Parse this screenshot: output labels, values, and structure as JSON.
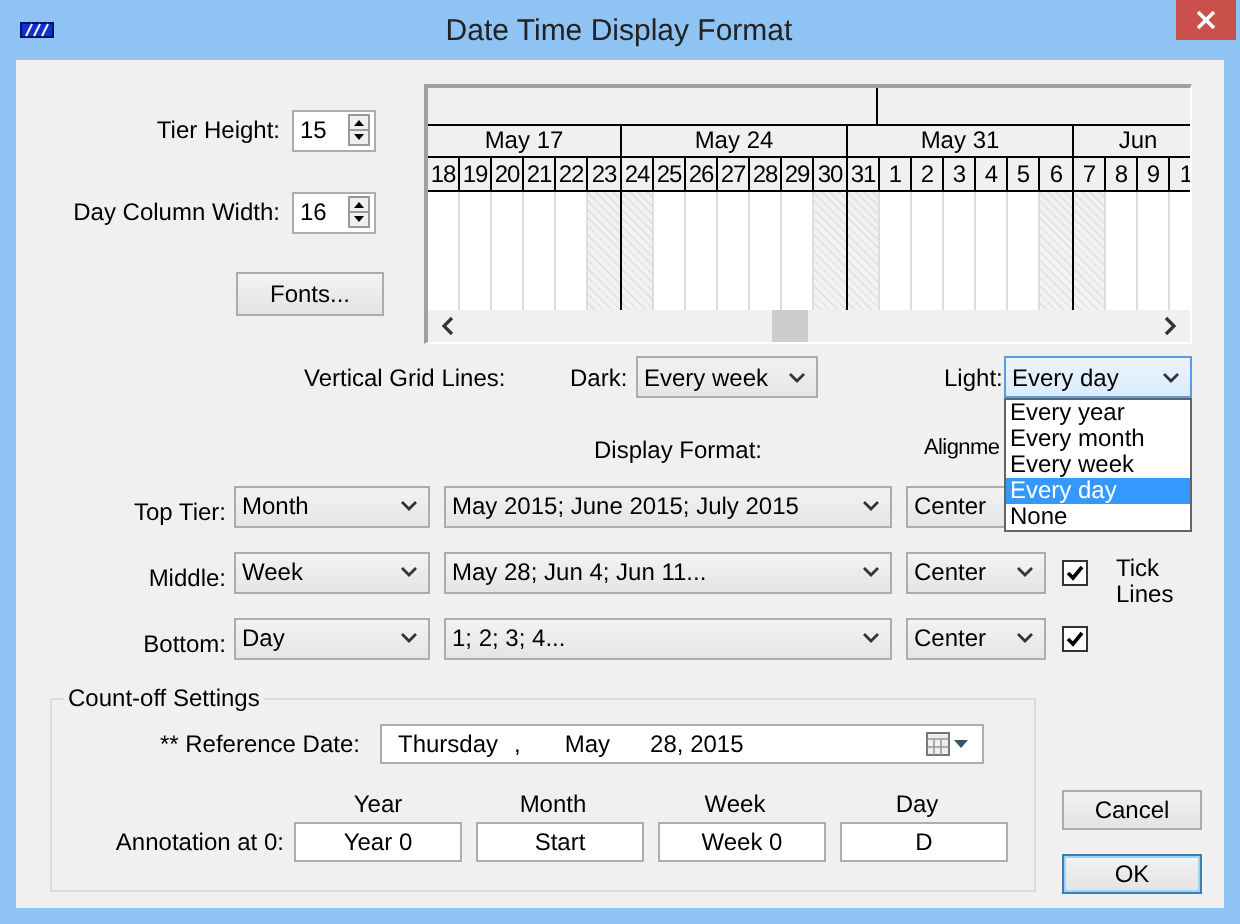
{
  "window": {
    "title": "Date Time Display Format"
  },
  "tier_height": {
    "label": "Tier Height:",
    "value": "15"
  },
  "day_column_width": {
    "label": "Day Column Width:",
    "value": "16"
  },
  "fonts_button": "Fonts...",
  "timeline": {
    "weeks": [
      {
        "label": "May 17",
        "days": [
          {
            "label": "18",
            "weekend": false
          },
          {
            "label": "19",
            "weekend": false
          },
          {
            "label": "20",
            "weekend": false
          },
          {
            "label": "21",
            "weekend": false
          },
          {
            "label": "22",
            "weekend": false
          },
          {
            "label": "23",
            "weekend": true
          }
        ]
      },
      {
        "label": "May 24",
        "days": [
          {
            "label": "24",
            "weekend": true
          },
          {
            "label": "25",
            "weekend": false
          },
          {
            "label": "26",
            "weekend": false
          },
          {
            "label": "27",
            "weekend": false
          },
          {
            "label": "28",
            "weekend": false
          },
          {
            "label": "29",
            "weekend": false
          },
          {
            "label": "30",
            "weekend": true
          }
        ]
      },
      {
        "label": "May 31",
        "days": [
          {
            "label": "31",
            "weekend": true
          },
          {
            "label": "1",
            "weekend": false
          },
          {
            "label": "2",
            "weekend": false
          },
          {
            "label": "3",
            "weekend": false
          },
          {
            "label": "4",
            "weekend": false
          },
          {
            "label": "5",
            "weekend": false
          },
          {
            "label": "6",
            "weekend": true
          }
        ]
      },
      {
        "label": "Jun",
        "days": [
          {
            "label": "7",
            "weekend": true
          },
          {
            "label": "8",
            "weekend": false
          },
          {
            "label": "9",
            "weekend": false
          },
          {
            "label": "1",
            "weekend": false
          }
        ]
      }
    ]
  },
  "vertical_grid_lines": {
    "label": "Vertical Grid Lines:",
    "dark": {
      "label": "Dark:",
      "value": "Every week"
    },
    "light": {
      "label": "Light:",
      "value": "Every day",
      "open": true,
      "options": [
        {
          "label": "Every year",
          "selected": false
        },
        {
          "label": "Every month",
          "selected": false
        },
        {
          "label": "Every week",
          "selected": false
        },
        {
          "label": "Every day",
          "selected": true
        },
        {
          "label": "None",
          "selected": false
        }
      ]
    }
  },
  "tiers": {
    "display_format_header": "Display Format:",
    "alignment_header": "Alignme",
    "tick_lines_label": "Tick Lines",
    "rows": [
      {
        "label": "Top Tier:",
        "unit": "Month",
        "format": "May 2015; June 2015; July 2015",
        "alignment": "Center"
      },
      {
        "label": "Middle:",
        "unit": "Week",
        "format": "May 28; Jun 4; Jun 11...",
        "alignment": "Center",
        "tick_lines": true
      },
      {
        "label": "Bottom:",
        "unit": "Day",
        "format": "1; 2; 3; 4...",
        "alignment": "Center",
        "tick_lines": true
      }
    ]
  },
  "count_off": {
    "title": "Count-off Settings",
    "reference_date": {
      "label": "** Reference Date:",
      "parts": [
        "Thursday",
        ",",
        "May",
        "28, 2015"
      ]
    },
    "annotation": {
      "label": "Annotation at 0:",
      "fields": [
        {
          "header": "Year",
          "value": "Year 0"
        },
        {
          "header": "Month",
          "value": "Start"
        },
        {
          "header": "Week",
          "value": "Week 0"
        },
        {
          "header": "Day",
          "value": "D"
        }
      ]
    }
  },
  "buttons": [
    {
      "label": "Cancel",
      "default": false
    },
    {
      "label": "OK",
      "default": true
    }
  ]
}
